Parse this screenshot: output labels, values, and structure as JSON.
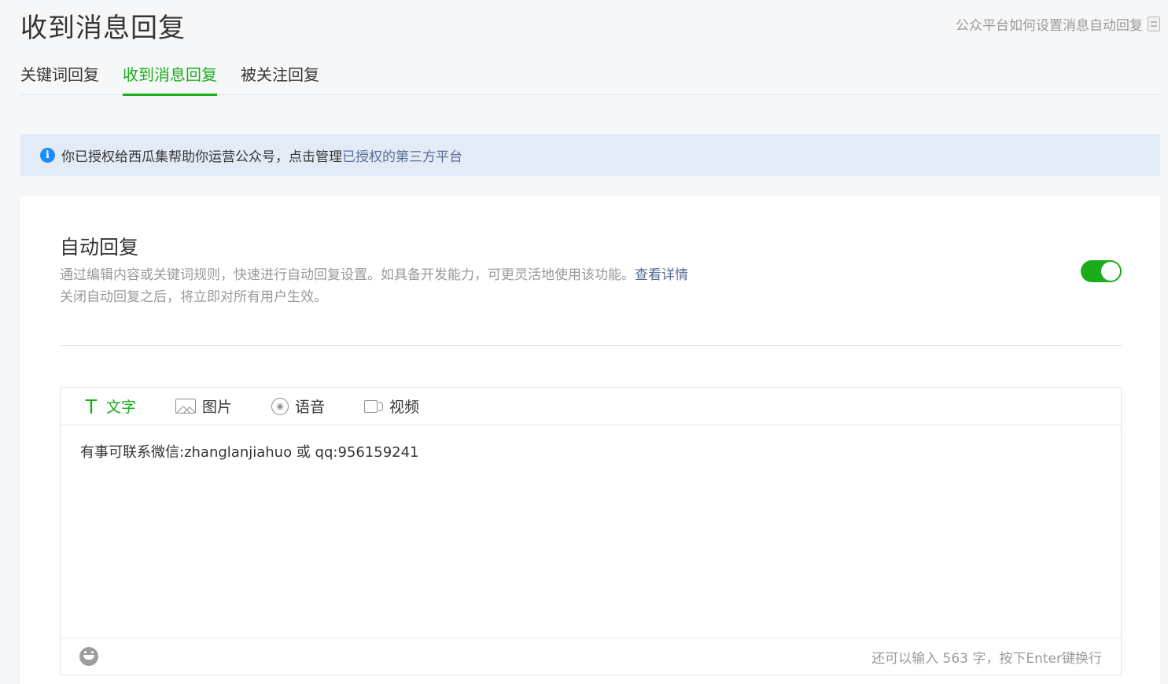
{
  "page": {
    "title": "收到消息回复",
    "help_link": "公众平台如何设置消息自动回复"
  },
  "tabs": [
    {
      "label": "关键词回复",
      "active": false
    },
    {
      "label": "收到消息回复",
      "active": true
    },
    {
      "label": "被关注回复",
      "active": false
    }
  ],
  "notice": {
    "text": "你已授权给西瓜集帮助你运营公众号，点击管理",
    "link": "已授权的第三方平台"
  },
  "auto_reply": {
    "title": "自动回复",
    "desc_line1": "通过编辑内容或关键词规则，快速进行自动回复设置。如具备开发能力，可更灵活地使用该功能。",
    "desc_link": "查看详情",
    "desc_line2": "关闭自动回复之后，将立即对所有用户生效。",
    "enabled": true
  },
  "editor": {
    "tabs": [
      {
        "label": "文字",
        "icon": "text-icon",
        "active": true
      },
      {
        "label": "图片",
        "icon": "image-icon",
        "active": false
      },
      {
        "label": "语音",
        "icon": "voice-icon",
        "active": false
      },
      {
        "label": "视频",
        "icon": "video-icon",
        "active": false
      }
    ],
    "content": "有事可联系微信:zhanglanjiahuo 或 qq:956159241",
    "counter": "还可以输入 563 字，按下Enter键换行"
  },
  "colors": {
    "accent": "#1aad19",
    "link": "#576b95",
    "notice_bg": "#e3ebf7",
    "info_icon": "#1a8cff"
  }
}
